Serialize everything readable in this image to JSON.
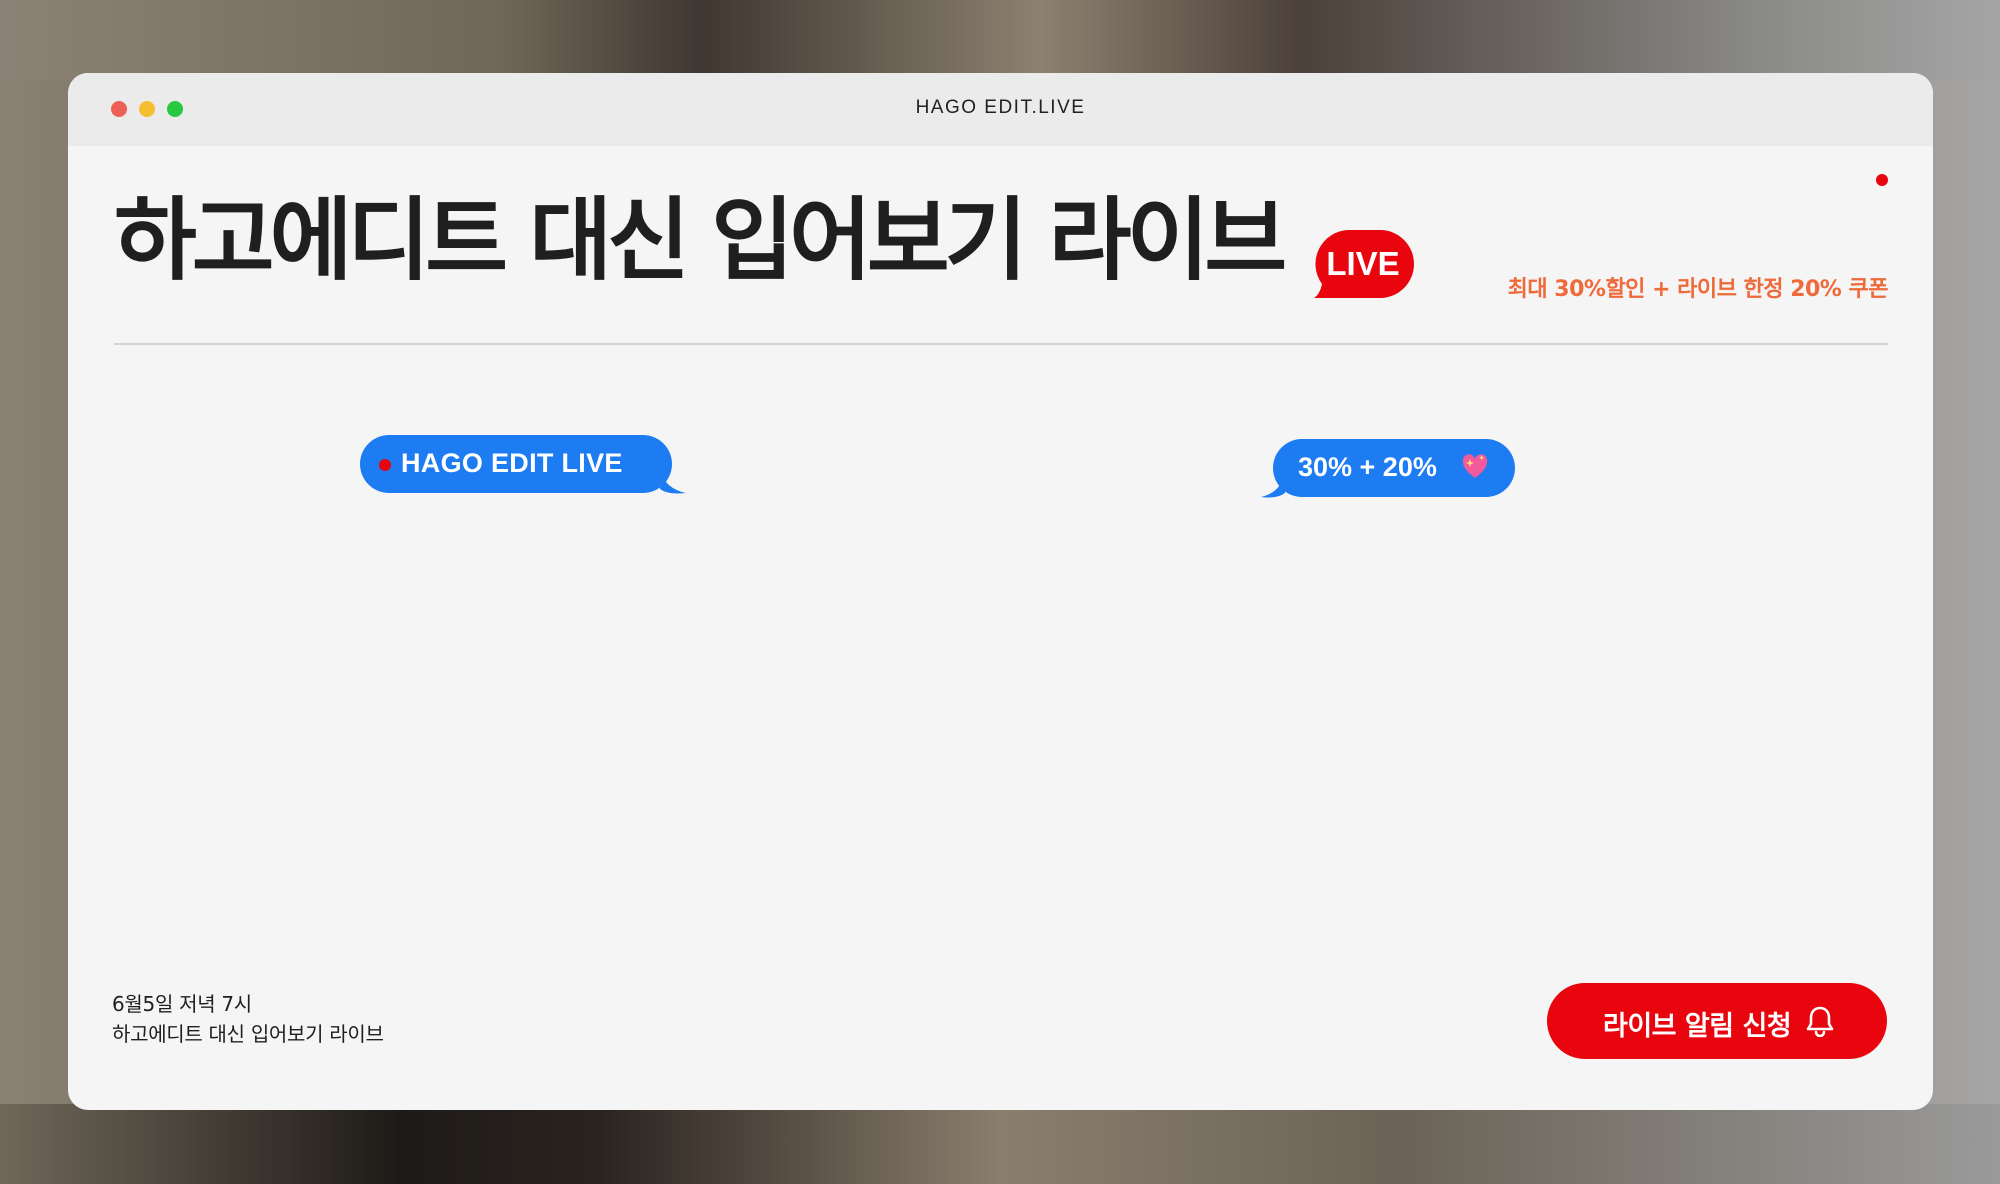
{
  "window": {
    "title": "HAGO EDIT.LIVE"
  },
  "hero": {
    "headline": "하고에디트 대신 입어보기 라이브",
    "live_badge": "LIVE",
    "promo": "최대 30%할인 + 라이브 한정 20% 쿠폰"
  },
  "bubbles": {
    "left": "HAGO EDIT LIVE",
    "right": "30% + 20%"
  },
  "event": {
    "date_line": "6월5일 저녁 7시",
    "name_line": "하고에디트 대신 입어보기 라이브"
  },
  "cta": {
    "label": "라이브 알림 신청"
  },
  "icons": {
    "heart": "sparkling-heart-icon",
    "bell": "bell-icon",
    "recording": "recording-dot-icon"
  },
  "colors": {
    "accent_red": "#e8050e",
    "bubble_blue": "#1d7cf2",
    "promo_orange": "#ef6a3a",
    "window_bg": "#f5f5f5"
  }
}
